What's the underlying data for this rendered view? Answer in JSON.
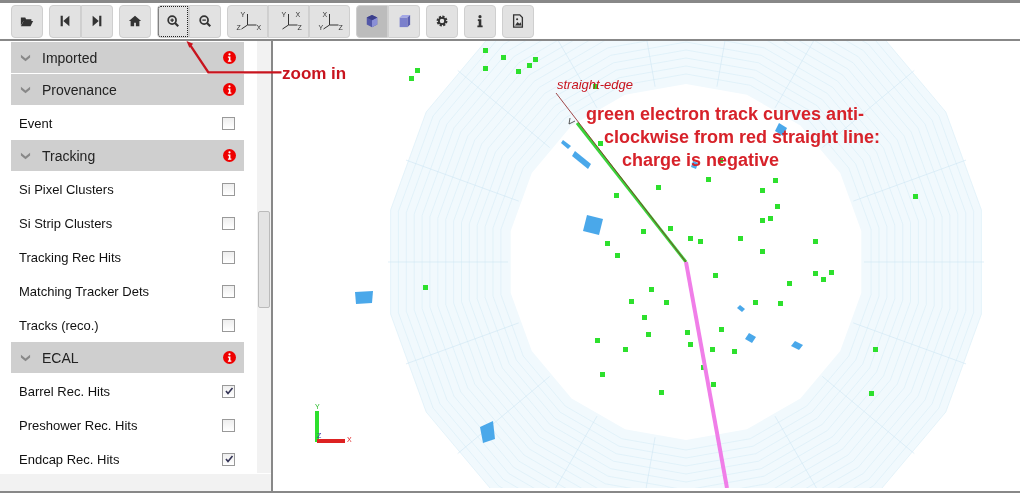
{
  "toolbar": {
    "groups": [
      {
        "buttons": [
          {
            "kind": "open",
            "pressed": false,
            "focused": false
          }
        ]
      },
      {
        "buttons": [
          {
            "kind": "first",
            "pressed": false,
            "focused": false
          },
          {
            "kind": "last",
            "pressed": false,
            "focused": false
          }
        ]
      },
      {
        "buttons": [
          {
            "kind": "home",
            "pressed": false,
            "focused": false
          }
        ]
      },
      {
        "buttons": [
          {
            "kind": "zoom-in",
            "pressed": false,
            "focused": true
          },
          {
            "kind": "zoom-out",
            "pressed": false,
            "focused": false
          }
        ]
      },
      {
        "buttons": [
          {
            "kind": "view",
            "pressed": false,
            "focused": false,
            "axis_labels": [
              "Y",
              "Z",
              "X"
            ]
          },
          {
            "kind": "view",
            "pressed": false,
            "focused": false,
            "axis_labels": [
              "Y",
              "X",
              "Z"
            ]
          },
          {
            "kind": "view",
            "pressed": false,
            "focused": false,
            "axis_labels": [
              "X",
              "Y",
              "Z"
            ]
          }
        ]
      },
      {
        "buttons": [
          {
            "kind": "perspective",
            "pressed": true,
            "focused": false
          },
          {
            "kind": "orthographic",
            "pressed": false,
            "focused": false
          }
        ]
      },
      {
        "buttons": [
          {
            "kind": "settings",
            "pressed": false,
            "focused": false
          }
        ]
      },
      {
        "buttons": [
          {
            "kind": "info",
            "pressed": false,
            "focused": false
          }
        ]
      },
      {
        "buttons": [
          {
            "kind": "image",
            "pressed": false,
            "focused": false
          }
        ]
      }
    ]
  },
  "sidebar": {
    "sections": [
      {
        "title": "Imported",
        "expanded": true
      },
      {
        "title": "Provenance",
        "expanded": true,
        "items": [
          {
            "label": "Event",
            "checked": false
          }
        ]
      },
      {
        "title": "Tracking",
        "expanded": true,
        "items": [
          {
            "label": "Si Pixel Clusters",
            "checked": false
          },
          {
            "label": "Si Strip Clusters",
            "checked": false
          },
          {
            "label": "Tracking Rec Hits",
            "checked": false
          },
          {
            "label": "Matching Tracker Dets",
            "checked": false
          },
          {
            "label": "Tracks (reco.)",
            "checked": false
          }
        ]
      },
      {
        "title": "ECAL",
        "expanded": true,
        "items": [
          {
            "label": "Barrel Rec. Hits",
            "checked": true
          },
          {
            "label": "Preshower Rec. Hits",
            "checked": false
          },
          {
            "label": "Endcap Rec. Hits",
            "checked": true
          }
        ]
      }
    ]
  },
  "view": {
    "axis_labels": [
      "Y",
      "Z",
      "X"
    ]
  },
  "annotations": {
    "zoom_label": "zoom in",
    "straight_edge_label": "straight-edge",
    "note_lines": [
      "green electron track curves anti-",
      "clockwise from red straight line:",
      "charge is negative"
    ]
  }
}
